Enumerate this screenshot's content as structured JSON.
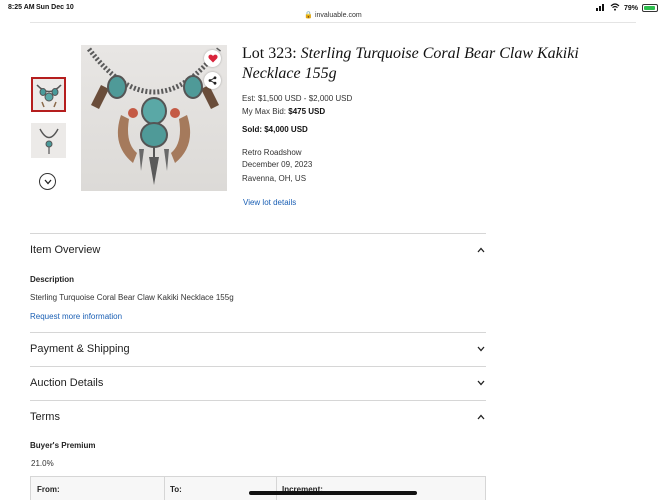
{
  "status_bar": {
    "time": "8:25 AM",
    "date": "Sun Dec 10",
    "url": "invaluable.com",
    "battery": "79%",
    "battery_level": 0.79
  },
  "gallery": {
    "thumbnails": [
      "necklace-front-thumbnail",
      "necklace-full-thumbnail"
    ],
    "more_icon": "chevron-down-icon"
  },
  "lot": {
    "prefix": "Lot 323: ",
    "title": "Sterling Turquoise Coral Bear Claw Kakiki Necklace 155g",
    "estimate": "Est: $1,500 USD - $2,000 USD",
    "max_bid_label": "My Max Bid:",
    "max_bid_value": "$475 USD",
    "sold": "Sold: $4,000 USD",
    "auction_house": "Retro Roadshow",
    "auction_date": "December 09, 2023",
    "location": "Ravenna, OH, US",
    "view_details": "View lot details"
  },
  "sections": {
    "overview": {
      "title": "Item Overview",
      "description_label": "Description",
      "description": "Sterling Turquoise Coral Bear Claw Kakiki Necklace 155g",
      "request_link": "Request more information"
    },
    "payment": {
      "title": "Payment & Shipping"
    },
    "auction": {
      "title": "Auction Details"
    },
    "terms": {
      "title": "Terms",
      "premium_label": "Buyer's Premium",
      "premium_value": "21.0%",
      "table_headers": [
        "From:",
        "To:",
        "Increment:"
      ]
    }
  },
  "colors": {
    "link": "#1a5fb4",
    "favorite": "#d9243c",
    "active_thumb_border": "#b51e1e"
  }
}
